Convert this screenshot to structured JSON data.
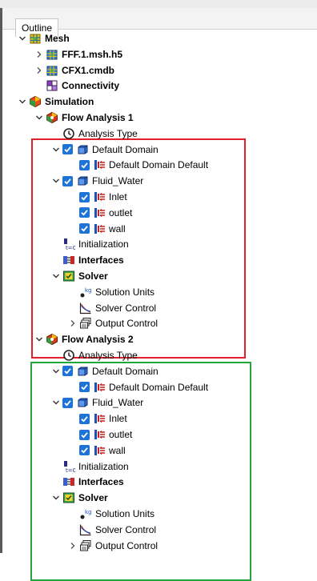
{
  "panel": {
    "tab_label": "Outline"
  },
  "colors": {
    "highlight_flow1": "#e0202a",
    "highlight_flow2": "#22a83a",
    "checkbox": "#1e74d6"
  },
  "tree": [
    {
      "id": "mesh",
      "label": "Mesh",
      "level": 0,
      "toggle": "expanded",
      "icon": "mesh-icon",
      "bold": true,
      "checkbox": false
    },
    {
      "id": "fff-msh",
      "label": "FFF.1.msh.h5",
      "level": 1,
      "toggle": "collapsed",
      "icon": "mesh-file-icon",
      "bold": true,
      "checkbox": false
    },
    {
      "id": "cfx1-cmdb",
      "label": "CFX1.cmdb",
      "level": 1,
      "toggle": "collapsed",
      "icon": "mesh-file-icon",
      "bold": true,
      "checkbox": false
    },
    {
      "id": "connectivity",
      "label": "Connectivity",
      "level": 1,
      "toggle": "none",
      "icon": "connectivity-icon",
      "bold": true,
      "checkbox": false
    },
    {
      "id": "simulation",
      "label": "Simulation",
      "level": 0,
      "toggle": "expanded",
      "icon": "simulation-icon",
      "bold": true,
      "checkbox": false
    },
    {
      "id": "flow-analysis-1",
      "label": "Flow Analysis 1",
      "level": 1,
      "toggle": "expanded",
      "icon": "flow-analysis-icon",
      "bold": true,
      "checkbox": false
    },
    {
      "id": "fa1-analysis-type",
      "label": "Analysis Type",
      "level": 2,
      "toggle": "none",
      "icon": "clock-icon",
      "bold": false,
      "checkbox": false
    },
    {
      "id": "fa1-default-domain",
      "label": "Default Domain",
      "level": 2,
      "toggle": "expanded",
      "icon": "domain-icon",
      "bold": false,
      "checkbox": true
    },
    {
      "id": "fa1-default-domain-default",
      "label": "Default Domain Default",
      "level": 3,
      "toggle": "none",
      "icon": "boundary-icon",
      "bold": false,
      "checkbox": true
    },
    {
      "id": "fa1-fluid-water",
      "label": "Fluid_Water",
      "level": 2,
      "toggle": "expanded",
      "icon": "domain-icon",
      "bold": false,
      "checkbox": true
    },
    {
      "id": "fa1-inlet",
      "label": "Inlet",
      "level": 3,
      "toggle": "none",
      "icon": "boundary-icon",
      "bold": false,
      "checkbox": true
    },
    {
      "id": "fa1-outlet",
      "label": "outlet",
      "level": 3,
      "toggle": "none",
      "icon": "boundary-icon",
      "bold": false,
      "checkbox": true
    },
    {
      "id": "fa1-wall",
      "label": "wall",
      "level": 3,
      "toggle": "none",
      "icon": "boundary-icon",
      "bold": false,
      "checkbox": true
    },
    {
      "id": "fa1-initialization",
      "label": "Initialization",
      "level": 2,
      "toggle": "none",
      "icon": "initialization-icon",
      "bold": false,
      "checkbox": false
    },
    {
      "id": "fa1-interfaces",
      "label": "Interfaces",
      "level": 2,
      "toggle": "none",
      "icon": "interfaces-icon",
      "bold": true,
      "checkbox": false
    },
    {
      "id": "fa1-solver",
      "label": "Solver",
      "level": 2,
      "toggle": "expanded",
      "icon": "solver-icon",
      "bold": true,
      "checkbox": false
    },
    {
      "id": "fa1-solution-units",
      "label": "Solution Units",
      "level": 3,
      "toggle": "none",
      "icon": "units-icon",
      "bold": false,
      "checkbox": false
    },
    {
      "id": "fa1-solver-control",
      "label": "Solver Control",
      "level": 3,
      "toggle": "none",
      "icon": "solver-control-icon",
      "bold": false,
      "checkbox": false
    },
    {
      "id": "fa1-output-control",
      "label": "Output Control",
      "level": 3,
      "toggle": "collapsed",
      "icon": "output-control-icon",
      "bold": false,
      "checkbox": false
    },
    {
      "id": "flow-analysis-2",
      "label": "Flow Analysis 2",
      "level": 1,
      "toggle": "expanded",
      "icon": "flow-analysis-icon",
      "bold": true,
      "checkbox": false
    },
    {
      "id": "fa2-analysis-type",
      "label": "Analysis Type",
      "level": 2,
      "toggle": "none",
      "icon": "clock-icon",
      "bold": false,
      "checkbox": false
    },
    {
      "id": "fa2-default-domain",
      "label": "Default Domain",
      "level": 2,
      "toggle": "expanded",
      "icon": "domain-icon",
      "bold": false,
      "checkbox": true
    },
    {
      "id": "fa2-default-domain-default",
      "label": "Default Domain Default",
      "level": 3,
      "toggle": "none",
      "icon": "boundary-icon",
      "bold": false,
      "checkbox": true
    },
    {
      "id": "fa2-fluid-water",
      "label": "Fluid_Water",
      "level": 2,
      "toggle": "expanded",
      "icon": "domain-icon",
      "bold": false,
      "checkbox": true
    },
    {
      "id": "fa2-inlet",
      "label": "Inlet",
      "level": 3,
      "toggle": "none",
      "icon": "boundary-icon",
      "bold": false,
      "checkbox": true
    },
    {
      "id": "fa2-outlet",
      "label": "outlet",
      "level": 3,
      "toggle": "none",
      "icon": "boundary-icon",
      "bold": false,
      "checkbox": true
    },
    {
      "id": "fa2-wall",
      "label": "wall",
      "level": 3,
      "toggle": "none",
      "icon": "boundary-icon",
      "bold": false,
      "checkbox": true
    },
    {
      "id": "fa2-initialization",
      "label": "Initialization",
      "level": 2,
      "toggle": "none",
      "icon": "initialization-icon",
      "bold": false,
      "checkbox": false
    },
    {
      "id": "fa2-interfaces",
      "label": "Interfaces",
      "level": 2,
      "toggle": "none",
      "icon": "interfaces-icon",
      "bold": true,
      "checkbox": false
    },
    {
      "id": "fa2-solver",
      "label": "Solver",
      "level": 2,
      "toggle": "expanded",
      "icon": "solver-icon",
      "bold": true,
      "checkbox": false
    },
    {
      "id": "fa2-solution-units",
      "label": "Solution Units",
      "level": 3,
      "toggle": "none",
      "icon": "units-icon",
      "bold": false,
      "checkbox": false
    },
    {
      "id": "fa2-solver-control",
      "label": "Solver Control",
      "level": 3,
      "toggle": "none",
      "icon": "solver-control-icon",
      "bold": false,
      "checkbox": false
    },
    {
      "id": "fa2-output-control",
      "label": "Output Control",
      "level": 3,
      "toggle": "collapsed",
      "icon": "output-control-icon",
      "bold": false,
      "checkbox": false
    }
  ]
}
